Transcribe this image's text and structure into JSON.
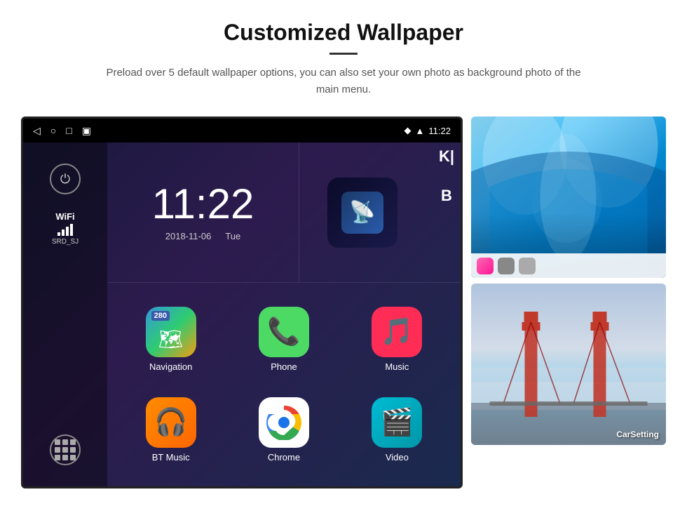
{
  "header": {
    "title": "Customized Wallpaper",
    "description": "Preload over 5 default wallpaper options, you can also set your own photo as background photo of the main menu."
  },
  "status_bar": {
    "time": "11:22",
    "icons": [
      "back",
      "home",
      "recents",
      "screenshot"
    ]
  },
  "clock": {
    "time": "11:22",
    "date": "2018-11-06",
    "day": "Tue"
  },
  "sidebar": {
    "wifi_label": "WiFi",
    "wifi_ssid": "SRD_SJ"
  },
  "apps": [
    {
      "name": "Navigation",
      "type": "navigation"
    },
    {
      "name": "Phone",
      "type": "phone"
    },
    {
      "name": "Music",
      "type": "music"
    },
    {
      "name": "BT Music",
      "type": "bt"
    },
    {
      "name": "Chrome",
      "type": "chrome"
    },
    {
      "name": "Video",
      "type": "video"
    }
  ],
  "wallpapers": {
    "label1": "CarSetting"
  }
}
